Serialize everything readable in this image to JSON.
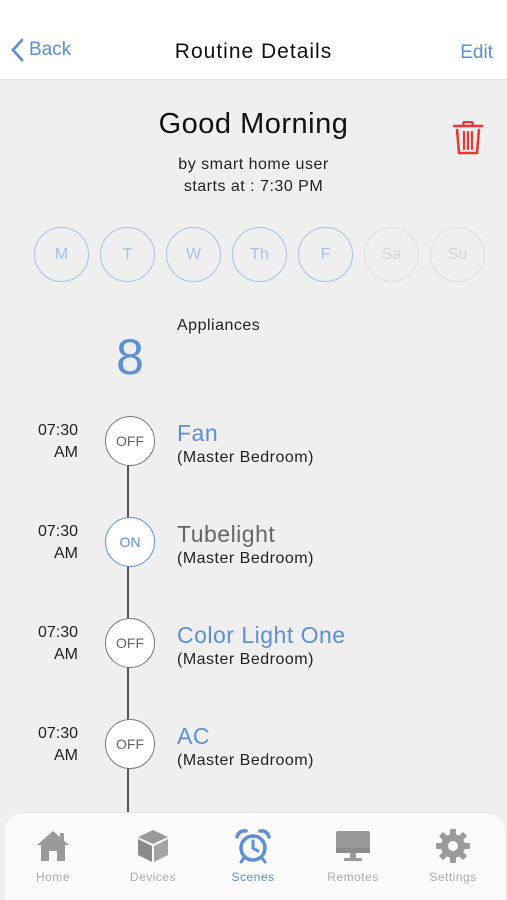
{
  "header": {
    "back_label": "Back",
    "title": "Routine Details",
    "edit_label": "Edit"
  },
  "routine": {
    "name": "Good Morning",
    "byline": "by smart home user",
    "starts": "starts at : 7:30 PM",
    "days": [
      {
        "label": "M",
        "active": true
      },
      {
        "label": "T",
        "active": true
      },
      {
        "label": "W",
        "active": true
      },
      {
        "label": "Th",
        "active": true
      },
      {
        "label": "F",
        "active": true
      },
      {
        "label": "Sa",
        "active": false
      },
      {
        "label": "Su",
        "active": false
      }
    ]
  },
  "appliances": {
    "count": "8",
    "label": "Appliances"
  },
  "schedule": [
    {
      "time_hm": "07:30",
      "time_ampm": "AM",
      "state": "OFF",
      "name": "Fan",
      "room": "(Master Bedroom)"
    },
    {
      "time_hm": "07:30",
      "time_ampm": "AM",
      "state": "ON",
      "name": "Tubelight",
      "room": "(Master Bedroom)"
    },
    {
      "time_hm": "07:30",
      "time_ampm": "AM",
      "state": "OFF",
      "name": "Color Light One",
      "room": "(Master Bedroom)"
    },
    {
      "time_hm": "07:30",
      "time_ampm": "AM",
      "state": "OFF",
      "name": "AC",
      "room": "(Master Bedroom)"
    }
  ],
  "tabs": [
    {
      "label": "Home",
      "icon": "house-icon",
      "active": false
    },
    {
      "label": "Devices",
      "icon": "cube-icon",
      "active": false
    },
    {
      "label": "Scenes",
      "icon": "alarm-clock-icon",
      "active": true
    },
    {
      "label": "Remotes",
      "icon": "monitor-icon",
      "active": false
    },
    {
      "label": "Settings",
      "icon": "gear-icon",
      "active": false
    }
  ],
  "colors": {
    "accent": "#5b8fd6",
    "delete": "#e53935",
    "background": "#efefef",
    "inactive_icon": "#9a9a9a"
  }
}
